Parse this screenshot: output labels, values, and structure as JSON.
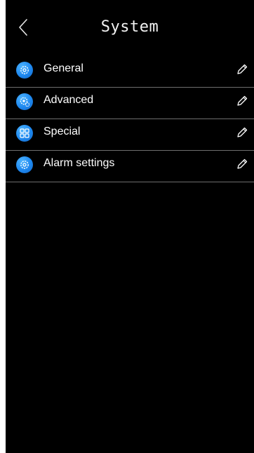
{
  "header": {
    "title": "System",
    "back_icon": "chevron-left-icon"
  },
  "menu": {
    "items": [
      {
        "label": "General",
        "icon": "gear-icon",
        "action_icon": "pencil-icon"
      },
      {
        "label": "Advanced",
        "icon": "advanced-gear-icon",
        "action_icon": "pencil-icon"
      },
      {
        "label": "Special",
        "icon": "grid-icon",
        "action_icon": "pencil-icon"
      },
      {
        "label": "Alarm settings",
        "icon": "alarm-gear-icon",
        "action_icon": "pencil-icon"
      }
    ]
  },
  "colors": {
    "background": "#000000",
    "text": "#ffffff",
    "divider": "#6e6e6e",
    "icon_accent": "#1e88ef"
  }
}
